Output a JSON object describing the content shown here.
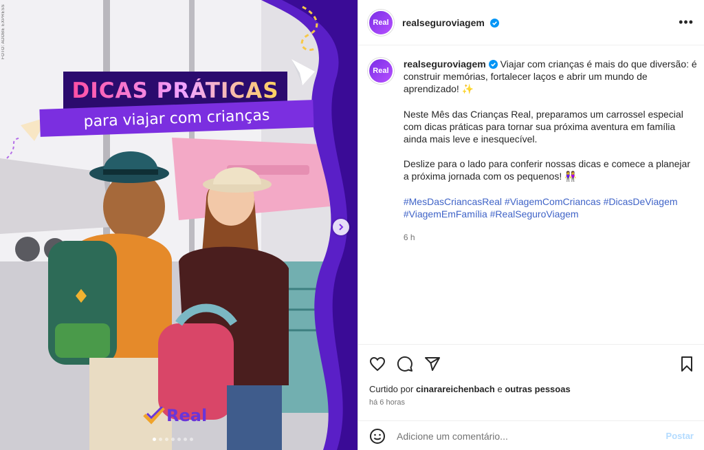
{
  "media": {
    "credit": "FOTO: ADOBE EXPRESS",
    "title": "DICAS PRÁTICAS",
    "subtitle": "para viajar com crianças",
    "brand": "Real",
    "carousel_dots": 7,
    "carousel_active": 0
  },
  "post": {
    "username": "realseguroviagem",
    "avatar_text": "Real",
    "caption": {
      "p1": "Viajar com crianças é mais do que diversão: é construir memórias, fortalecer laços e abrir um mundo de aprendizado! ✨",
      "p2": "Neste Mês das Crianças Real, preparamos um carrossel especial com dicas práticas para tornar sua próxima aventura em família ainda mais leve e inesquecível.",
      "p3": "Deslize para o lado para conferir nossas dicas e comece a planejar a próxima jornada com os pequenos! 👭",
      "hashtags": "#MesDasCriancasReal #ViagemComCriancas #DicasDeViagem #ViagemEmFamília #RealSeguroViagem",
      "time": "6 h"
    },
    "likes": {
      "prefix": "Curtido por",
      "user": "cinarareichenbach",
      "joiner": "e",
      "others": "outras pessoas"
    },
    "posted_ago": "há 6 horas",
    "comment_placeholder": "Adicione um comentário...",
    "post_button": "Postar"
  },
  "colors": {
    "brand_purple": "#7a2ee6",
    "dark_purple": "#2b0b6e",
    "hashtag_blue": "#3f63c7",
    "verified_blue": "#0095f6"
  },
  "icons": [
    "heart-icon",
    "comment-icon",
    "share-icon",
    "bookmark-icon",
    "emoji-icon",
    "more-icon",
    "verified-icon",
    "chevron-right-icon"
  ]
}
